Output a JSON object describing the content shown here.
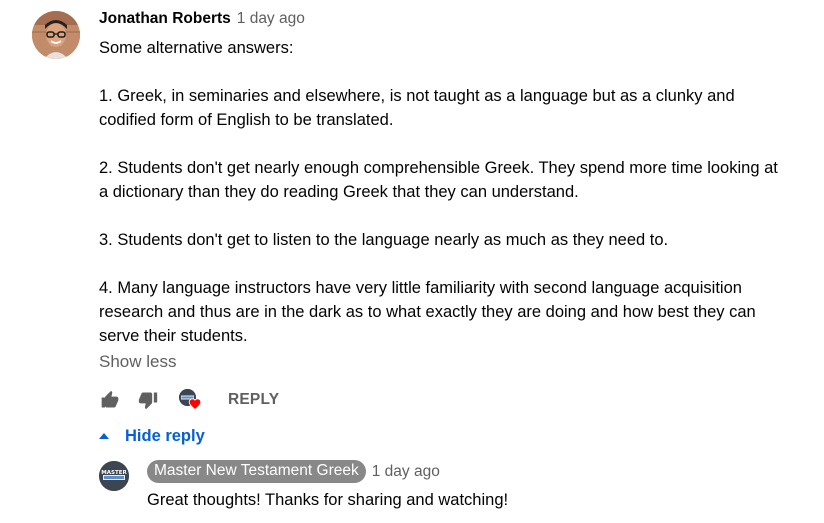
{
  "comment": {
    "author": "Jonathan Roberts",
    "timestamp": "1 day ago",
    "text": "Some alternative answers:\n\n1. Greek, in seminaries and elsewhere, is not taught as a language but as a clunky and codified form of English to be translated.\n\n2.  Students don't get nearly enough comprehensible Greek. They spend more time looking at a dictionary than they do reading Greek that they can understand.\n\n3. Students don't get to listen to the language nearly as much as they need to.\n\n4. Many language instructors have very little familiarity with second language acquisition research and thus are in the dark as to what exactly they are doing and how best they can serve their students.",
    "show_less_label": "Show less",
    "actions": {
      "like_icon": "thumb-up-icon",
      "dislike_icon": "thumb-down-icon",
      "creator_heart_icon": "creator-heart-icon",
      "reply_label": "REPLY"
    }
  },
  "replies": {
    "toggle_label": "Hide reply",
    "toggle_icon": "caret-up-icon",
    "items": [
      {
        "author": "Master New Testament Greek",
        "timestamp": "1 day ago",
        "text": "Great thoughts! Thanks for sharing and watching!",
        "avatar_text": "MASTER NT GREEK"
      }
    ]
  },
  "colors": {
    "link_blue": "#065fd4",
    "secondary_text": "#606060",
    "creator_pill_bg": "#888888",
    "heart_red": "#ff0000"
  }
}
